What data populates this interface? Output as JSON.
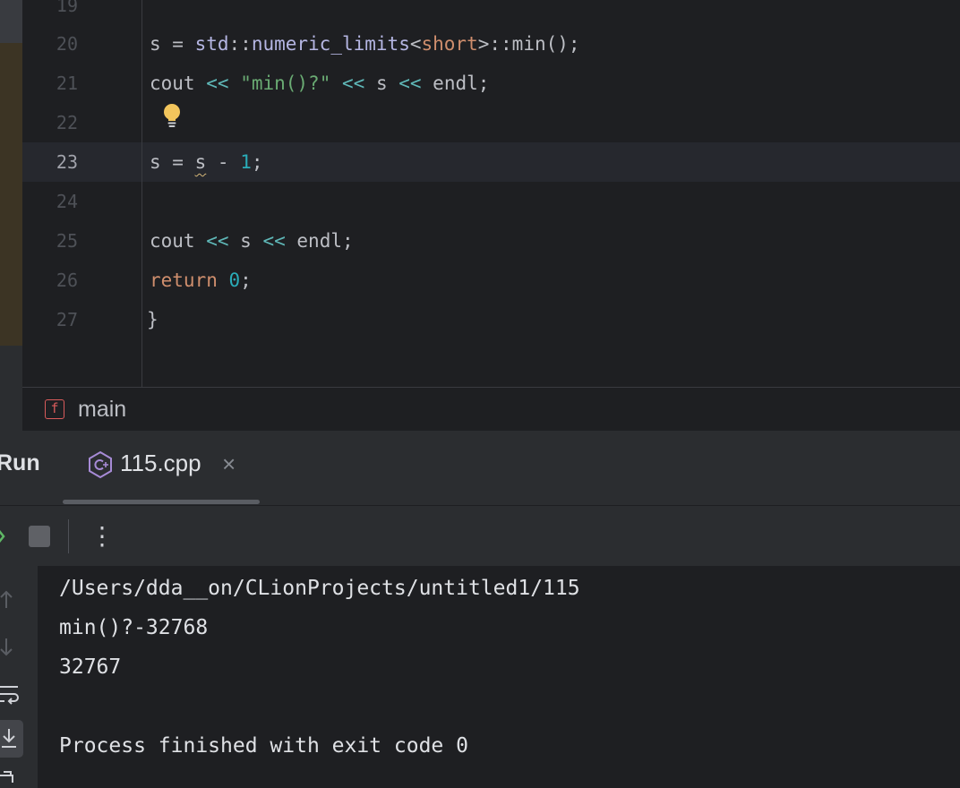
{
  "editor": {
    "lines": [
      {
        "number": "19"
      },
      {
        "number": "20"
      },
      {
        "number": "21"
      },
      {
        "number": "22"
      },
      {
        "number": "23"
      },
      {
        "number": "24"
      },
      {
        "number": "25"
      },
      {
        "number": "26"
      },
      {
        "number": "27"
      }
    ],
    "current_line": "23",
    "tokens": {
      "l20": [
        "s",
        " = ",
        "std",
        "::",
        "numeric_limits",
        "<",
        "short",
        ">",
        "::",
        "min",
        "();"
      ],
      "l21": [
        "cout",
        " ",
        "<<",
        " ",
        "\"min()?\"",
        " ",
        "<<",
        " s ",
        "<<",
        " endl;"
      ],
      "l23": [
        "s",
        " = ",
        "s",
        " - ",
        "1",
        ";"
      ],
      "l25": [
        "cout",
        " ",
        "<<",
        " s ",
        "<<",
        " endl;"
      ],
      "l26": [
        "return",
        " ",
        "0",
        ";"
      ],
      "l27": [
        "}"
      ]
    }
  },
  "breadcrumb": {
    "badge": "f",
    "label": "main"
  },
  "run": {
    "title": "Run",
    "tab_label": "115.cpp",
    "tab_close": "×",
    "more": "⋮"
  },
  "console": {
    "lines": [
      "/Users/dda__on/CLionProjects/untitled1/115",
      "min()?-32768",
      "32767",
      "",
      "Process finished with exit code 0"
    ]
  },
  "colors": {
    "editor_bg": "#1e1f22",
    "panel_bg": "#2b2d30",
    "keyword": "#cf8e6d",
    "string": "#6aab73",
    "number": "#2aacb8",
    "warning_underline": "#d5b778"
  }
}
